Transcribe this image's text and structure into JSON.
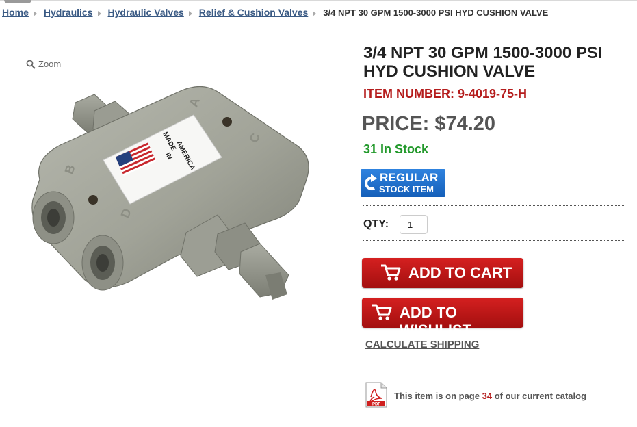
{
  "breadcrumb": {
    "items": [
      "Home",
      "Hydraulics",
      "Hydraulic Valves",
      "Relief & Cushion Valves"
    ],
    "current": "3/4 NPT 30 GPM 1500-3000 PSI HYD CUSHION VALVE"
  },
  "gallery": {
    "zoom_label": "Zoom",
    "label_text": [
      "MADE",
      "IN",
      "AMERICA"
    ]
  },
  "product": {
    "title": "3/4 NPT 30 GPM 1500-3000 PSI HYD CUSHION VALVE",
    "item_number": "ITEM NUMBER: 9-4019-75-H",
    "price": "PRICE: $74.20",
    "stock": "31 In Stock",
    "badge_line1": "REGULAR",
    "badge_line2": "STOCK ITEM"
  },
  "form": {
    "qty_label": "QTY:",
    "qty_value": "1",
    "add_to_cart": "ADD TO CART",
    "add_to_wishlist": "ADD TO WISHLIST",
    "calculate_shipping": "CALCULATE SHIPPING"
  },
  "catalog": {
    "prefix": "This item is on page",
    "page": "34",
    "suffix": "of our current catalog",
    "pdf_label": "PDF"
  },
  "colors": {
    "link": "#3a5a84",
    "item_number": "#b51d1d",
    "stock": "#22992b",
    "badge": "#1f6fcf",
    "button": "#c01818"
  },
  "icons": [
    "search-icon",
    "breadcrumb-arrow-icon",
    "refresh-icon",
    "cart-icon",
    "pdf-icon"
  ]
}
